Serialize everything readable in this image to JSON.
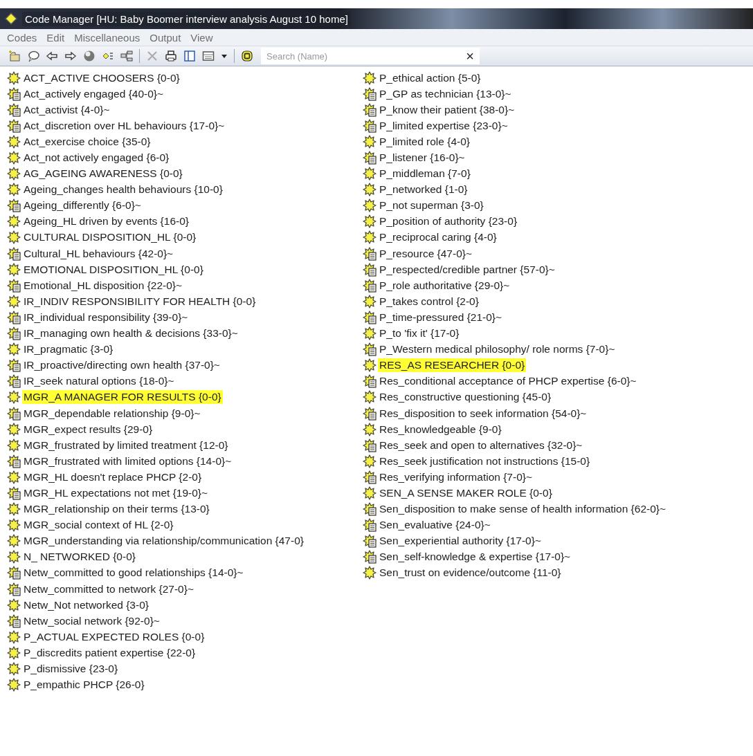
{
  "window": {
    "title": "Code Manager [HU: Baby Boomer interview analysis August 10 home]"
  },
  "menu": [
    "Codes",
    "Edit",
    "Miscellaneous",
    "Output",
    "View"
  ],
  "toolbar": [
    {
      "kind": "new-code"
    },
    {
      "kind": "comment"
    },
    {
      "kind": "back"
    },
    {
      "kind": "forward"
    },
    {
      "kind": "ball"
    },
    {
      "kind": "diamond"
    },
    {
      "kind": "tree"
    },
    {
      "kind": "separator"
    },
    {
      "kind": "delete"
    },
    {
      "kind": "print"
    },
    {
      "kind": "pane"
    },
    {
      "kind": "grid"
    },
    {
      "kind": "dropdown"
    },
    {
      "kind": "separator"
    },
    {
      "kind": "filter"
    }
  ],
  "search": {
    "placeholder": "Search (Name)",
    "clear": "×"
  },
  "columns": [
    [
      {
        "label": "ACT_ACTIVE CHOOSERS {0-0}",
        "kind": "code",
        "highlighted": false
      },
      {
        "label": "Act_actively engaged {40-0}~",
        "kind": "memo",
        "highlighted": false
      },
      {
        "label": "Act_activist {4-0}~",
        "kind": "memo",
        "highlighted": false
      },
      {
        "label": "Act_discretion over HL behaviours {17-0}~",
        "kind": "memo",
        "highlighted": false
      },
      {
        "label": "Act_exercise choice {35-0}",
        "kind": "code",
        "highlighted": false
      },
      {
        "label": "Act_not actively engaged {6-0}",
        "kind": "code",
        "highlighted": false
      },
      {
        "label": "AG_AGEING AWARENESS {0-0}",
        "kind": "code",
        "highlighted": false
      },
      {
        "label": "Ageing_changes health behaviours {10-0}",
        "kind": "code",
        "highlighted": false
      },
      {
        "label": "Ageing_differently {6-0}~",
        "kind": "memo",
        "highlighted": false
      },
      {
        "label": "Ageing_HL driven by events {16-0}",
        "kind": "code",
        "highlighted": false
      },
      {
        "label": "CULTURAL DISPOSITION_HL {0-0}",
        "kind": "code",
        "highlighted": false
      },
      {
        "label": "Cultural_HL behaviours {42-0}~",
        "kind": "memo",
        "highlighted": false
      },
      {
        "label": "EMOTIONAL DISPOSITION_HL {0-0}",
        "kind": "code",
        "highlighted": false
      },
      {
        "label": "Emotional_HL disposition {22-0}~",
        "kind": "memo",
        "highlighted": false
      },
      {
        "label": "IR_INDIV RESPONSIBILITY FOR HEALTH {0-0}",
        "kind": "code",
        "highlighted": false
      },
      {
        "label": "IR_individual responsibility {39-0}~",
        "kind": "memo",
        "highlighted": false
      },
      {
        "label": "IR_managing own health & decisions {33-0}~",
        "kind": "memo",
        "highlighted": false
      },
      {
        "label": "IR_pragmatic {3-0}",
        "kind": "code",
        "highlighted": false
      },
      {
        "label": "IR_proactive/directing own health {37-0}~",
        "kind": "memo",
        "highlighted": false
      },
      {
        "label": "IR_seek natural options {18-0}~",
        "kind": "memo",
        "highlighted": false
      },
      {
        "label": "MGR_A MANAGER FOR RESULTS {0-0}",
        "kind": "code",
        "highlighted": true
      },
      {
        "label": "MGR_dependable relationship {9-0}~",
        "kind": "memo",
        "highlighted": false
      },
      {
        "label": "MGR_expect results {29-0}",
        "kind": "code",
        "highlighted": false
      },
      {
        "label": "MGR_frustrated by limited treatment {12-0}",
        "kind": "code",
        "highlighted": false
      },
      {
        "label": "MGR_frustrated with limited options {14-0}~",
        "kind": "memo",
        "highlighted": false
      },
      {
        "label": "MGR_HL doesn't replace PHCP {2-0}",
        "kind": "code",
        "highlighted": false
      },
      {
        "label": "MGR_HL expectations not met {19-0}~",
        "kind": "memo",
        "highlighted": false
      },
      {
        "label": "MGR_relationship on their terms {13-0}",
        "kind": "code",
        "highlighted": false
      },
      {
        "label": "MGR_social context of HL {2-0}",
        "kind": "code",
        "highlighted": false
      },
      {
        "label": "MGR_understanding via relationship/communication {47-0}",
        "kind": "code",
        "highlighted": false
      },
      {
        "label": "N_ NETWORKED {0-0}",
        "kind": "code",
        "highlighted": false
      },
      {
        "label": "Netw_committed to good relationships {14-0}~",
        "kind": "memo",
        "highlighted": false
      },
      {
        "label": "Netw_committed to network {27-0}~",
        "kind": "memo",
        "highlighted": false
      },
      {
        "label": "Netw_Not networked {3-0}",
        "kind": "code",
        "highlighted": false
      },
      {
        "label": "Netw_social network {92-0}~",
        "kind": "memo",
        "highlighted": false
      },
      {
        "label": "P_ACTUAL EXPECTED ROLES {0-0}",
        "kind": "code",
        "highlighted": false
      },
      {
        "label": "P_discredits patient expertise {22-0}",
        "kind": "code",
        "highlighted": false
      },
      {
        "label": "P_dismissive {23-0}",
        "kind": "code",
        "highlighted": false
      },
      {
        "label": "P_empathic PHCP {26-0}",
        "kind": "code",
        "highlighted": false
      }
    ],
    [
      {
        "label": "P_ethical action {5-0}",
        "kind": "code",
        "highlighted": false
      },
      {
        "label": "P_GP as technician {13-0}~",
        "kind": "memo",
        "highlighted": false
      },
      {
        "label": "P_know their patient {38-0}~",
        "kind": "memo",
        "highlighted": false
      },
      {
        "label": "P_limited expertise {23-0}~",
        "kind": "memo",
        "highlighted": false
      },
      {
        "label": "P_limited role {4-0}",
        "kind": "code",
        "highlighted": false
      },
      {
        "label": "P_listener {16-0}~",
        "kind": "memo",
        "highlighted": false
      },
      {
        "label": "P_middleman {7-0}",
        "kind": "code",
        "highlighted": false
      },
      {
        "label": "P_networked {1-0}",
        "kind": "code",
        "highlighted": false
      },
      {
        "label": "P_not superman {3-0}",
        "kind": "code",
        "highlighted": false
      },
      {
        "label": "P_position of authority {23-0}",
        "kind": "code",
        "highlighted": false
      },
      {
        "label": "P_reciprocal caring {4-0}",
        "kind": "code",
        "highlighted": false
      },
      {
        "label": "P_resource {47-0}~",
        "kind": "memo",
        "highlighted": false
      },
      {
        "label": "P_respected/credible partner {57-0}~",
        "kind": "memo",
        "highlighted": false
      },
      {
        "label": "P_role authoritative {29-0}~",
        "kind": "memo",
        "highlighted": false
      },
      {
        "label": "P_takes control {2-0}",
        "kind": "code",
        "highlighted": false
      },
      {
        "label": "P_time-pressured {21-0}~",
        "kind": "memo",
        "highlighted": false
      },
      {
        "label": "P_to 'fix it' {17-0}",
        "kind": "code",
        "highlighted": false
      },
      {
        "label": "P_Western medical philosophy/ role norms {7-0}~",
        "kind": "memo",
        "highlighted": false
      },
      {
        "label": "RES_AS RESEARCHER {0-0}",
        "kind": "code",
        "highlighted": true
      },
      {
        "label": "Res_conditional acceptance of PHCP expertise {6-0}~",
        "kind": "memo",
        "highlighted": false
      },
      {
        "label": "Res_constructive questioning {45-0}",
        "kind": "code",
        "highlighted": false
      },
      {
        "label": "Res_disposition to seek information {54-0}~",
        "kind": "memo",
        "highlighted": false
      },
      {
        "label": "Res_knowledgeable {9-0}",
        "kind": "code",
        "highlighted": false
      },
      {
        "label": "Res_seek and open to alternatives {32-0}~",
        "kind": "memo",
        "highlighted": false
      },
      {
        "label": "Res_seek justification not instructions {15-0}",
        "kind": "code",
        "highlighted": false
      },
      {
        "label": "Res_verifying information {7-0}~",
        "kind": "memo",
        "highlighted": false
      },
      {
        "label": "SEN_A SENSE MAKER ROLE {0-0}",
        "kind": "code",
        "highlighted": false
      },
      {
        "label": "Sen_disposition to make sense of health information {62-0}~",
        "kind": "memo",
        "highlighted": false
      },
      {
        "label": "Sen_evaluative {24-0}~",
        "kind": "memo",
        "highlighted": false
      },
      {
        "label": "Sen_experiential authority {17-0}~",
        "kind": "memo",
        "highlighted": false
      },
      {
        "label": "Sen_self-knowledge & expertise {17-0}~",
        "kind": "memo",
        "highlighted": false
      },
      {
        "label": "Sen_trust on evidence/outcome {11-0}",
        "kind": "code",
        "highlighted": false
      }
    ]
  ]
}
